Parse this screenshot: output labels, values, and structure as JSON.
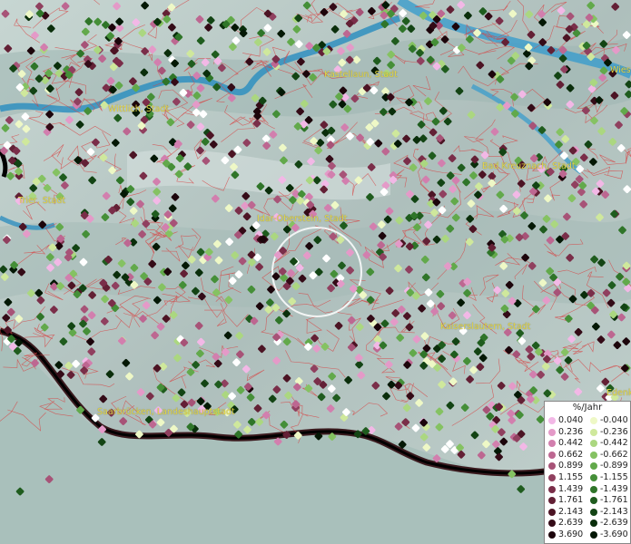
{
  "map": {
    "cities": [
      {
        "name": "Kastellaun, Stadt"
      },
      {
        "name": "Wittlich, Stadt"
      },
      {
        "name": "Bad Kreuznach, Stadt"
      },
      {
        "name": "Trier, Stadt"
      },
      {
        "name": "Idar-Oberstein, Stadt"
      },
      {
        "name": "Kaiserslautern, Stadt"
      },
      {
        "name": "Saarbrücken, Landeshauptstadt"
      },
      {
        "name": "Edenk"
      },
      {
        "name": "Wies"
      }
    ]
  },
  "legend": {
    "title": "%/Jahr",
    "positive": [
      {
        "label": "0.040",
        "color": "#f2b8e6"
      },
      {
        "label": "0.236",
        "color": "#e49ac8"
      },
      {
        "label": "0.442",
        "color": "#d27fae"
      },
      {
        "label": "0.662",
        "color": "#bd6791"
      },
      {
        "label": "0.899",
        "color": "#a75377"
      },
      {
        "label": "1.155",
        "color": "#90405f"
      },
      {
        "label": "1.439",
        "color": "#7a2e49"
      },
      {
        "label": "1.761",
        "color": "#632035"
      },
      {
        "label": "2.143",
        "color": "#4c1424"
      },
      {
        "label": "2.639",
        "color": "#340b17"
      },
      {
        "label": "3.690",
        "color": "#1c050b"
      }
    ],
    "negative": [
      {
        "label": "-0.040",
        "color": "#eef8c6"
      },
      {
        "label": "-0.236",
        "color": "#cfe89c"
      },
      {
        "label": "-0.442",
        "color": "#abd780"
      },
      {
        "label": "-0.662",
        "color": "#85c262"
      },
      {
        "label": "-0.899",
        "color": "#62a94b"
      },
      {
        "label": "-1.155",
        "color": "#458f38"
      },
      {
        "label": "-1.439",
        "color": "#2f7529"
      },
      {
        "label": "-1.761",
        "color": "#1f5c1e"
      },
      {
        "label": "-2.143",
        "color": "#134414"
      },
      {
        "label": "-2.639",
        "color": "#0a2e0b"
      },
      {
        "label": "-3.690",
        "color": "#041805"
      }
    ]
  }
}
